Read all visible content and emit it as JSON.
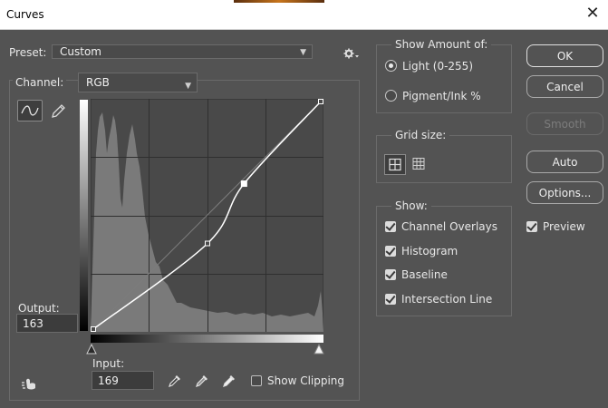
{
  "window": {
    "title": "Curves",
    "close_label": "✕"
  },
  "preset": {
    "label": "Preset:",
    "value": "Custom"
  },
  "channel": {
    "label": "Channel:",
    "value": "RGB"
  },
  "output": {
    "label": "Output:",
    "value": "163"
  },
  "input": {
    "label": "Input:",
    "value": "169"
  },
  "show_clipping": {
    "label": "Show Clipping",
    "checked": false
  },
  "show_amount": {
    "title": "Show Amount of:",
    "options": [
      {
        "label": "Light  (0-255)",
        "selected": true
      },
      {
        "label": "Pigment/Ink %",
        "selected": false
      }
    ]
  },
  "grid_size": {
    "title": "Grid size:"
  },
  "show": {
    "title": "Show:",
    "items": [
      {
        "label": "Channel Overlays",
        "checked": true
      },
      {
        "label": "Histogram",
        "checked": true
      },
      {
        "label": "Baseline",
        "checked": true
      },
      {
        "label": "Intersection Line",
        "checked": true
      }
    ]
  },
  "buttons": {
    "ok": "OK",
    "cancel": "Cancel",
    "smooth": "Smooth",
    "auto": "Auto",
    "options": "Options..."
  },
  "preview": {
    "label": "Preview",
    "checked": true
  },
  "curve": {
    "input_range": [
      0,
      255
    ],
    "output_range": [
      0,
      255
    ],
    "points": [
      [
        0,
        0
      ],
      [
        128,
        96
      ],
      [
        169,
        163
      ],
      [
        255,
        255
      ]
    ]
  },
  "colors": {
    "background": "#535353",
    "graph_bg": "#494949",
    "histogram": "#7a7a7a",
    "grid": "#2f2f2f"
  }
}
